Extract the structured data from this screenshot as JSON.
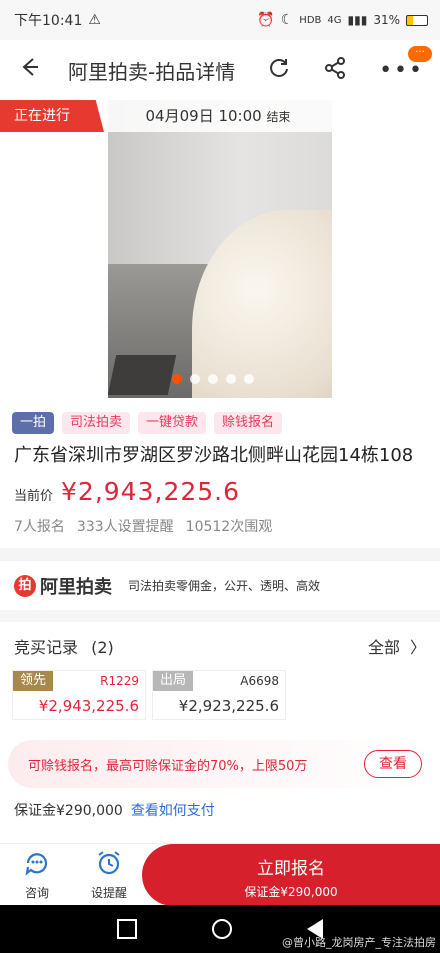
{
  "status": {
    "time": "下午10:41",
    "battery": "31%",
    "net1": "HDB",
    "net2": "4G"
  },
  "header": {
    "title": "阿里拍卖-拍品详情",
    "badge": "···"
  },
  "hero": {
    "status_tag": "正在进行",
    "end_time": "04月09日 10:00",
    "end_word": "结束"
  },
  "tags": [
    "一拍",
    "司法拍卖",
    "一键贷款",
    "赊钱报名"
  ],
  "item": {
    "title": "广东省深圳市罗湖区罗沙路北侧畔山花园14栋108",
    "price_label": "当前价",
    "price": "¥2,943,225.6",
    "signups": "7人报名",
    "reminders": "333人设置提醒",
    "views": "10512次围观"
  },
  "ali": {
    "brand": "阿里拍卖",
    "desc": "司法拍卖零佣金，公开、透明、高效"
  },
  "bids": {
    "title": "竞买记录",
    "count": "(2)",
    "all": "全部",
    "records": [
      {
        "role": "领先",
        "code": "R1229",
        "amount": "¥2,943,225.6",
        "color": "#e0253a"
      },
      {
        "role": "出局",
        "code": "A6698",
        "amount": "¥2,923,225.6",
        "color": "#333333"
      }
    ]
  },
  "loan": {
    "text": "可赊钱报名，最高可赊保证金的70%，上限50万",
    "button": "查看"
  },
  "deposit": {
    "label": "保证金",
    "amount": "¥290,000",
    "link": "查看如何支付"
  },
  "bottom": {
    "consult": "咨询",
    "remind": "设提醒",
    "signup": "立即报名",
    "signup_sub": "保证金¥290,000"
  },
  "watermark": "@曾小路_龙岗房产_专注法拍房"
}
